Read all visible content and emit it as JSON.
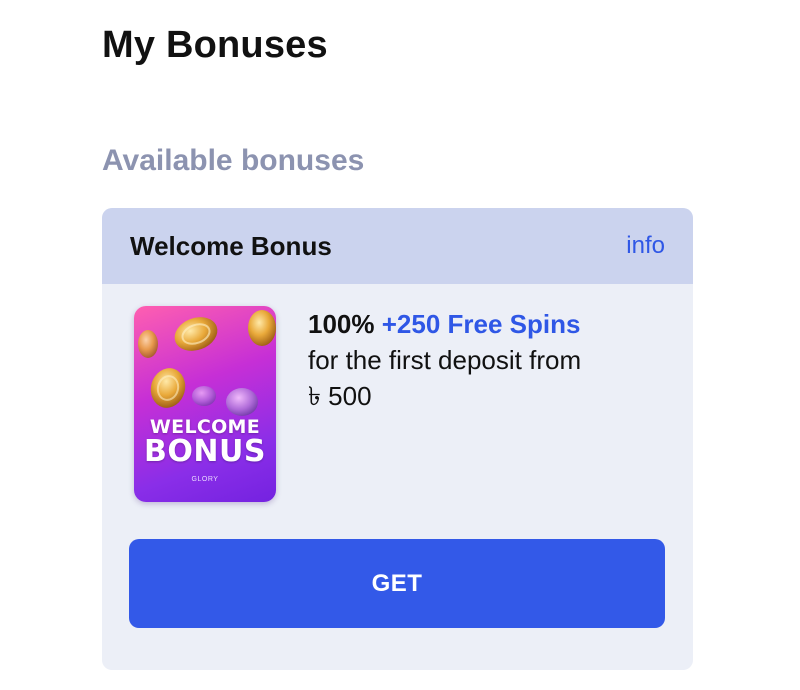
{
  "page": {
    "title": "My Bonuses"
  },
  "section": {
    "title": "Available bonuses"
  },
  "bonus": {
    "title": "Welcome Bonus",
    "info_label": "info",
    "image": {
      "line1": "WELCOME",
      "line2": "BONUS",
      "brand": "GLORY"
    },
    "offer": {
      "percent": "100%",
      "spins": "+250 Free Spins",
      "condition": "for the first deposit from",
      "amount": "৳ 500"
    },
    "button_label": "GET"
  },
  "colors": {
    "accent": "#3359e8",
    "link": "#2f57e6",
    "card_header": "#cbd3ee",
    "card_body": "#eceff7",
    "section_title": "#8c93b0"
  }
}
